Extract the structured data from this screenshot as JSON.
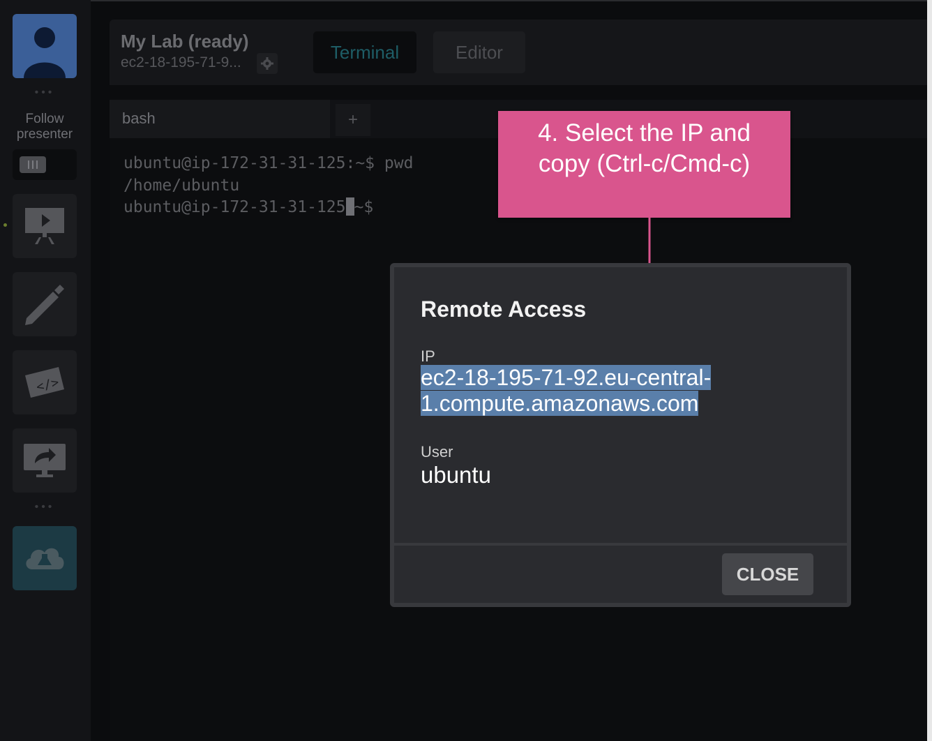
{
  "sidebar": {
    "follow_label_line1": "Follow",
    "follow_label_line2": "presenter",
    "icons": [
      "user-avatar-icon",
      "presentation-icon",
      "pen-icon",
      "code-ticket-icon",
      "screen-share-icon",
      "cloud-lab-icon"
    ]
  },
  "header": {
    "lab_title": "My Lab (ready)",
    "lab_host": "ec2-18-195-71-9...",
    "tabs": [
      {
        "label": "Terminal",
        "active": true
      },
      {
        "label": "Editor",
        "active": false
      }
    ]
  },
  "terminal": {
    "tab_label": "bash",
    "add_tab_label": "+",
    "lines": [
      "ubuntu@ip-172-31-31-125:~$ pwd",
      "/home/ubuntu",
      "ubuntu@ip-172-31-31-125"
    ],
    "line3_tail": "~$"
  },
  "callout": {
    "line1": "4. Select the IP and",
    "line2": "copy (Ctrl-c/Cmd-c)",
    "color": "#d9558d"
  },
  "dialog": {
    "title": "Remote Access",
    "ip_label": "IP",
    "ip_line1": "ec2-18-195-71-92.eu-central-",
    "ip_line2": "1.compute.amazonaws.com",
    "user_label": "User",
    "user_value": "ubuntu",
    "close_label": "CLOSE"
  },
  "colors": {
    "accent": "#1e5d66",
    "selection": "#5a7faa",
    "callout": "#d9558d"
  }
}
